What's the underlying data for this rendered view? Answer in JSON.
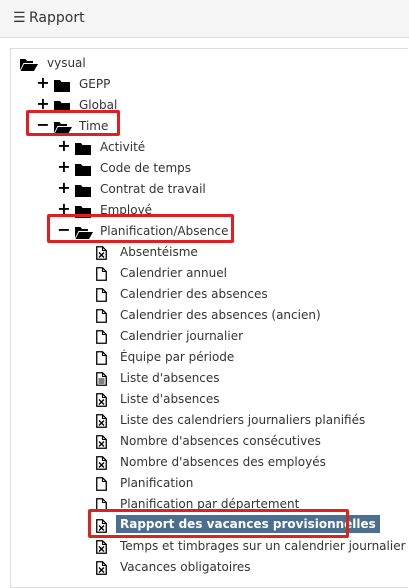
{
  "header": {
    "menu_icon": "hamburger-icon",
    "title": "Rapport"
  },
  "tree": {
    "root": {
      "label": "vysual",
      "icon": "folder-open-icon"
    },
    "nodes": [
      {
        "label": "GEPP",
        "icon": "folder-icon",
        "toggle": "+"
      },
      {
        "label": "Global",
        "icon": "folder-icon",
        "toggle": "+"
      },
      {
        "label": "Time",
        "icon": "folder-open-icon",
        "toggle": "−"
      },
      {
        "label": "Activité",
        "icon": "folder-icon",
        "toggle": "+"
      },
      {
        "label": "Code de temps",
        "icon": "folder-icon",
        "toggle": "+"
      },
      {
        "label": "Contrat de travail",
        "icon": "folder-icon",
        "toggle": "+"
      },
      {
        "label": "Employé",
        "icon": "folder-icon",
        "toggle": "+"
      },
      {
        "label": "Planification/Absence",
        "icon": "folder-open-icon",
        "toggle": "−"
      }
    ],
    "reports": [
      {
        "label": "Absentéisme",
        "icon": "excel-file-icon"
      },
      {
        "label": "Calendrier annuel",
        "icon": "file-icon"
      },
      {
        "label": "Calendrier des absences",
        "icon": "file-icon"
      },
      {
        "label": "Calendrier des absences (ancien)",
        "icon": "file-icon"
      },
      {
        "label": "Calendrier journalier",
        "icon": "file-icon"
      },
      {
        "label": "Équipe par période",
        "icon": "file-icon"
      },
      {
        "label": "Liste d'absences",
        "icon": "text-file-icon"
      },
      {
        "label": "Liste d'absences",
        "icon": "excel-file-icon"
      },
      {
        "label": "Liste des calendriers journaliers planifiés",
        "icon": "excel-file-icon"
      },
      {
        "label": "Nombre d'absences consécutives",
        "icon": "excel-file-icon"
      },
      {
        "label": "Nombre d'absences des employés",
        "icon": "excel-file-icon"
      },
      {
        "label": "Planification",
        "icon": "file-icon"
      },
      {
        "label": "Planification par département",
        "icon": "file-icon"
      },
      {
        "label": "Rapport des vacances provisionnelles",
        "icon": "excel-file-icon",
        "selected": true
      },
      {
        "label": "Temps et timbrages sur un calendrier journalier",
        "icon": "excel-file-icon"
      },
      {
        "label": "Vacances obligatoires",
        "icon": "excel-file-icon"
      }
    ]
  },
  "colors": {
    "highlight": "#e02020",
    "selected_bg": "#4c6e8f",
    "header_bg": "#f5f5f5"
  }
}
